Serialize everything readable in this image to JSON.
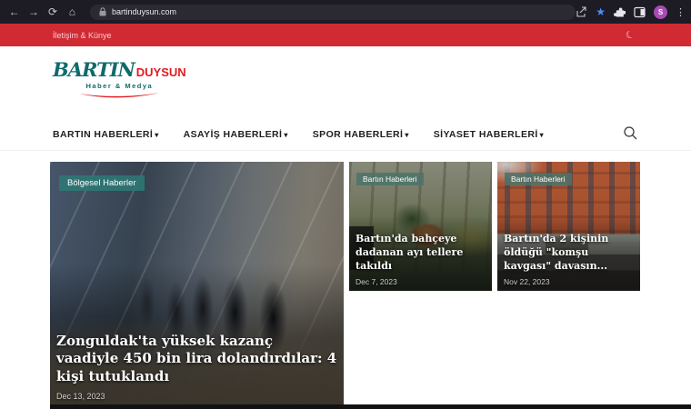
{
  "browser": {
    "url": "bartinduysun.com",
    "profile_initial": "S",
    "icons": {
      "back": "←",
      "forward": "→",
      "reload": "⟳",
      "home": "⌂",
      "star": "★",
      "menu": "⋮"
    }
  },
  "topbar": {
    "contact_link": "İletişim & Künye",
    "moon_icon": "☾"
  },
  "header": {
    "logo": {
      "name_teal": "BARTIN",
      "name_red": "DUYSUN",
      "tagline": "Haber & Medya"
    },
    "caret": "▾",
    "nav_items": [
      "BARTIN HABERLERİ",
      "ASAYİŞ HABERLERİ",
      "SPOR HABERLERİ",
      "SİYASET HABERLERİ"
    ]
  },
  "articles": {
    "main": {
      "badge": "Bölgesel Haberler",
      "title": "Zonguldak'ta yüksek kazanç vaadiyle 450 bin lira dolandırdılar: 4 kişi tutuklandı",
      "date": "Dec 13, 2023"
    },
    "secondary": [
      {
        "badge": "Bartın Haberleri",
        "title": "Bartın'da bahçeye dadanan ayı tellere takıldı",
        "date": "Dec 7, 2023"
      },
      {
        "badge": "Bartın Haberleri",
        "title": "Bartın'da 2 kişinin öldüğü \"komşu kavgası\" davasın...",
        "date": "Nov 22, 2023"
      }
    ]
  },
  "colors": {
    "accent_red": "#d02a33",
    "brand_teal": "#0e6b6d",
    "brand_red": "#e01b22",
    "badge_teal": "#2d7875",
    "chrome_dark": "#1d1c24",
    "bookmark_star_blue": "#4e8cf7",
    "avatar_purple": "#a94ab5"
  }
}
